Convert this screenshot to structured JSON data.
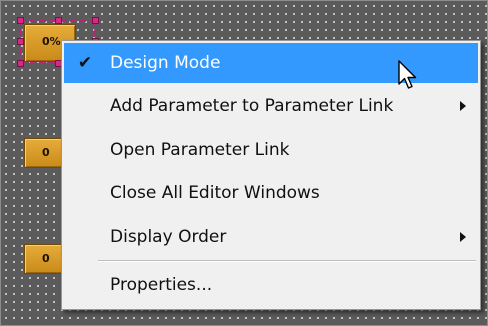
{
  "canvas": {
    "buttons": [
      {
        "label": "0%",
        "state": "selected"
      },
      {
        "label": "0"
      },
      {
        "label": "0"
      }
    ],
    "selection_color": "#c2217a"
  },
  "context_menu": {
    "highlight_color": "#3399ff",
    "items": [
      {
        "label": "Design Mode",
        "checked": true,
        "highlighted": true
      },
      {
        "label": "Add Parameter to Parameter Link",
        "submenu": true
      },
      {
        "label": "Open Parameter Link"
      },
      {
        "label": "Close All Editor Windows"
      },
      {
        "label": "Display Order",
        "submenu": true
      },
      {
        "label": "Properties..."
      }
    ],
    "check_glyph": "✔"
  },
  "cursor": {
    "icon": "arrow-pointer-icon"
  }
}
